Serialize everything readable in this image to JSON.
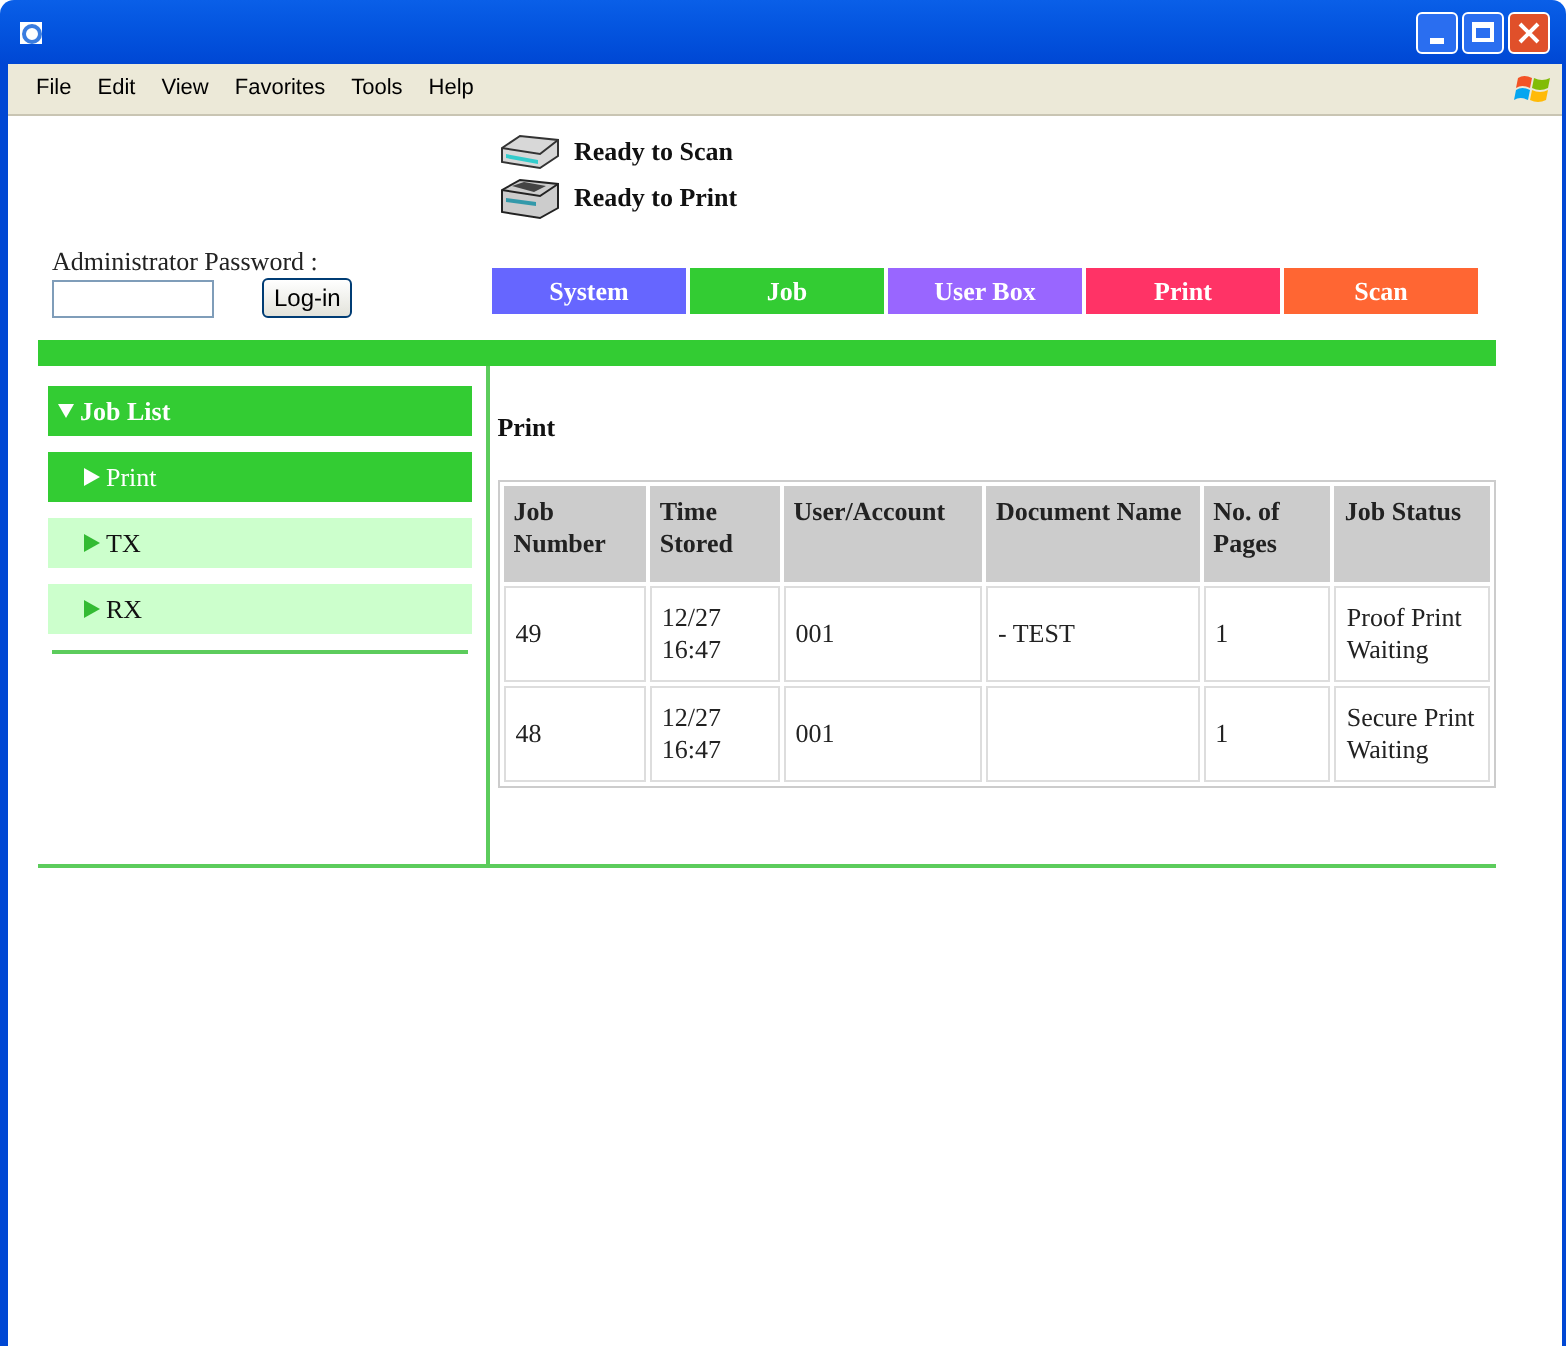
{
  "menu": [
    "File",
    "Edit",
    "View",
    "Favorites",
    "Tools",
    "Help"
  ],
  "status": [
    {
      "kind": "scanner",
      "text": "Ready to Scan"
    },
    {
      "kind": "printer",
      "text": "Ready to Print"
    }
  ],
  "login": {
    "label": "Administrator Password :",
    "button": "Log-in"
  },
  "tabs": [
    {
      "label": "System",
      "color": "#6666ff"
    },
    {
      "label": "Job",
      "color": "#33cc33"
    },
    {
      "label": "User Box",
      "color": "#9966ff"
    },
    {
      "label": "Print",
      "color": "#ff3366"
    },
    {
      "label": "Scan",
      "color": "#ff6633"
    }
  ],
  "sidebar": {
    "items": [
      {
        "label": "Job List",
        "expanded": true,
        "children": [
          {
            "label": "Print",
            "selected": true
          },
          {
            "label": "TX",
            "selected": false
          },
          {
            "label": "RX",
            "selected": false
          }
        ]
      }
    ]
  },
  "content": {
    "title": "Print",
    "table": {
      "columns": [
        "Job Number",
        "Time Stored",
        "User/Account",
        "Document Name",
        "No. of Pages",
        "Job Status"
      ],
      "rows": [
        [
          "49",
          "12/27 16:47",
          "001",
          "- TEST",
          "1",
          "Proof Print Waiting"
        ],
        [
          "48",
          "12/27 16:47",
          "001",
          "",
          "1",
          "Secure Print Waiting"
        ]
      ]
    }
  }
}
